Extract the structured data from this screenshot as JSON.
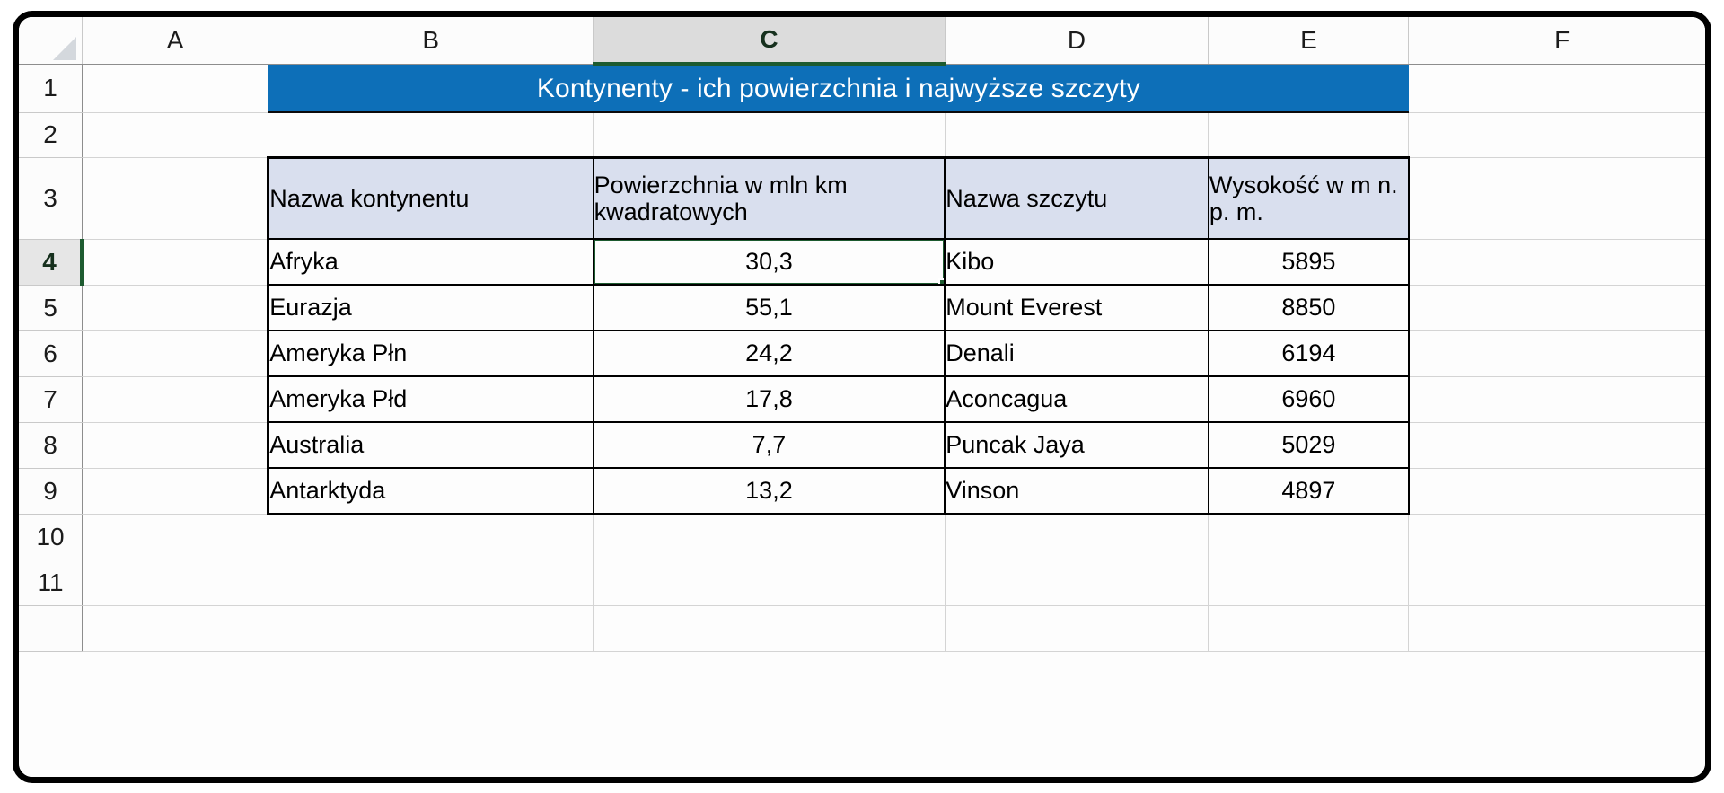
{
  "app": {
    "type": "spreadsheet",
    "active_cell": "C4",
    "active_column": "C",
    "active_row": "4",
    "accent_selection_color": "#1d5b30",
    "title_banner_color": "#0d6fb8",
    "table_header_fill": "#d9dfee"
  },
  "columns": [
    {
      "label": "A"
    },
    {
      "label": "B"
    },
    {
      "label": "C"
    },
    {
      "label": "D"
    },
    {
      "label": "E"
    },
    {
      "label": "F"
    }
  ],
  "rows": [
    {
      "label": "1"
    },
    {
      "label": "2"
    },
    {
      "label": "3"
    },
    {
      "label": "4"
    },
    {
      "label": "5"
    },
    {
      "label": "6"
    },
    {
      "label": "7"
    },
    {
      "label": "8"
    },
    {
      "label": "9"
    },
    {
      "label": "10"
    },
    {
      "label": "11"
    }
  ],
  "banner": {
    "text": "Kontynenty - ich powierzchnia i najwyższe szczyty"
  },
  "table": {
    "headers": [
      "Nazwa kontynentu",
      "Powierzchnia w mln km kwadratowych",
      "Nazwa szczytu",
      "Wysokość w m n. p. m."
    ],
    "rows": [
      {
        "continent": "Afryka",
        "area": "30,3",
        "peak": "Kibo",
        "height": "5895"
      },
      {
        "continent": "Eurazja",
        "area": "55,1",
        "peak": "Mount Everest",
        "height": "8850"
      },
      {
        "continent": "Ameryka Płn",
        "area": "24,2",
        "peak": "Denali",
        "height": "6194"
      },
      {
        "continent": "Ameryka Płd",
        "area": "17,8",
        "peak": "Aconcagua",
        "height": "6960"
      },
      {
        "continent": "Australia",
        "area": "7,7",
        "peak": "Puncak Jaya",
        "height": "5029"
      },
      {
        "continent": "Antarktyda",
        "area": "13,2",
        "peak": "Vinson",
        "height": "4897"
      }
    ]
  }
}
